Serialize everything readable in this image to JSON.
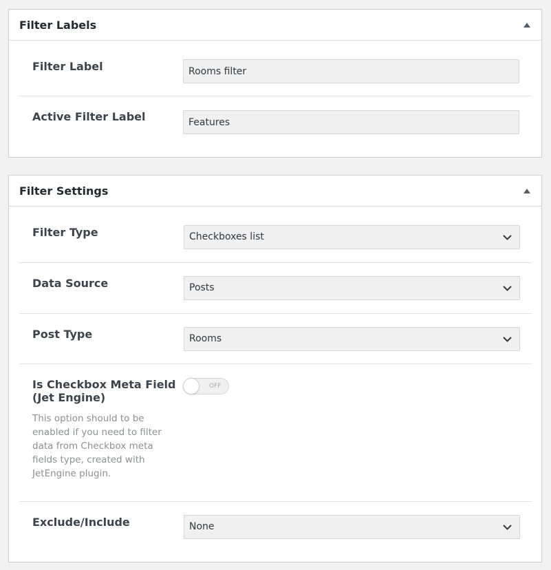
{
  "filter_labels": {
    "title": "Filter Labels",
    "filter_label": {
      "label": "Filter Label",
      "value": "Rooms filter"
    },
    "active_filter_label": {
      "label": "Active Filter Label",
      "value": "Features"
    }
  },
  "filter_settings": {
    "title": "Filter Settings",
    "filter_type": {
      "label": "Filter Type",
      "value": "Checkboxes list"
    },
    "data_source": {
      "label": "Data Source",
      "value": "Posts"
    },
    "post_type": {
      "label": "Post Type",
      "value": "Rooms"
    },
    "is_checkbox_meta_field": {
      "label_line1": "Is Checkbox Meta Field",
      "label_line2": "(Jet Engine)",
      "switch_text": "OFF",
      "description": "This option should to be enabled if you need to filter data from Checkbox meta fields type, created with JetEngine plugin."
    },
    "exclude_include": {
      "label": "Exclude/Include",
      "value": "None"
    }
  },
  "icons": {
    "collapse": "triangle-up-icon",
    "dropdown": "chevron-down-icon"
  },
  "colors": {
    "background": "#f1f1f1",
    "panel": "#ffffff",
    "field": "#f0f0f0",
    "text": "#23282d",
    "muted": "#8c8f94"
  }
}
